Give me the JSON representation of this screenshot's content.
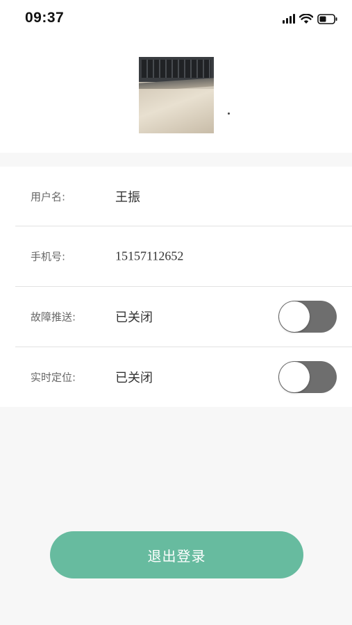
{
  "status_bar": {
    "time": "09:37",
    "icons": [
      "signal-icon",
      "wifi-icon",
      "battery-icon"
    ]
  },
  "profile": {
    "avatar_icon": "avatar-photo"
  },
  "rows": [
    {
      "label": "用户名:",
      "value": "王振"
    },
    {
      "label": "手机号:",
      "value": "15157112652"
    },
    {
      "label": "故障推送:",
      "value": "已关闭",
      "toggle_on": false
    },
    {
      "label": "实时定位:",
      "value": "已关闭",
      "toggle_on": false
    }
  ],
  "logout": {
    "label": "退出登录"
  },
  "colors": {
    "accent": "#67bb9f",
    "toggle_off": "#6e6e6e",
    "background": "#f7f7f7"
  }
}
